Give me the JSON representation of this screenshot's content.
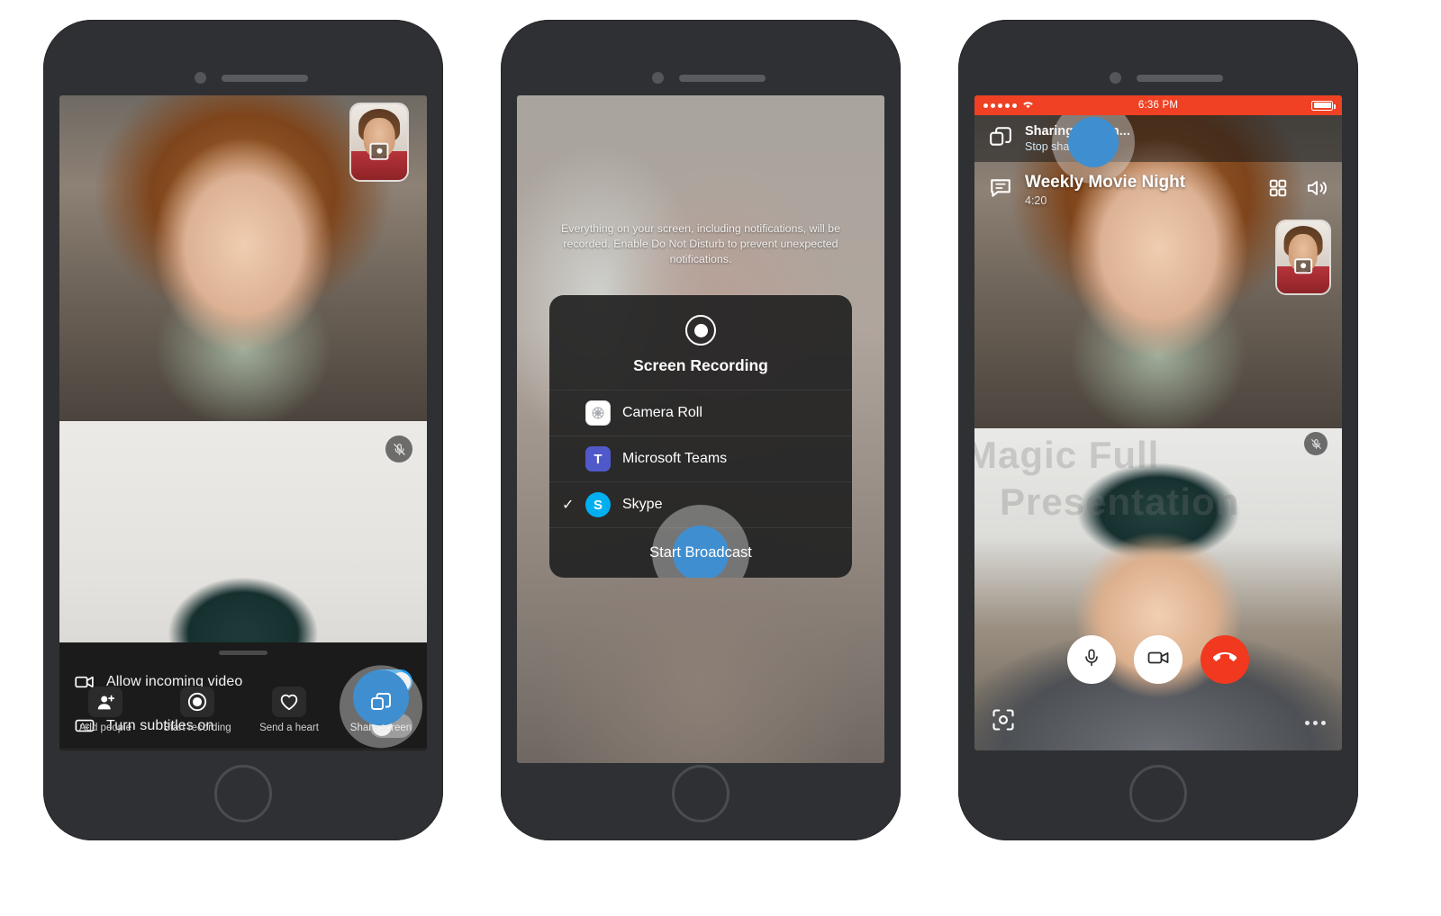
{
  "phone1": {
    "name": "skype-call-options-screen",
    "pip": {
      "icon": "camera-flip-icon"
    },
    "mute_badge": "mic-muted-icon",
    "options": [
      {
        "icon": "video-camera-icon",
        "label": "Allow incoming video",
        "toggle": "on"
      },
      {
        "icon": "closed-caption-icon",
        "label": "Turn subtitles on",
        "toggle": "off"
      }
    ],
    "actions": [
      {
        "icon": "add-person-icon",
        "label": "Add people"
      },
      {
        "icon": "record-circle-icon",
        "label": "Start recording"
      },
      {
        "icon": "heart-icon",
        "label": "Send a heart"
      },
      {
        "icon": "share-screen-icon",
        "label": "Share screen",
        "highlighted": true
      }
    ]
  },
  "phone2": {
    "name": "ios-screen-recording-broadcast-picker",
    "notice": "Everything on your screen, including notifications, will be recorded. Enable Do Not Disturb to prevent unexpected notifications.",
    "sheet_title": "Screen Recording",
    "sheet_icon": "record-circle-icon",
    "apps": [
      {
        "name": "Camera Roll",
        "icon": "camera-roll-icon",
        "selected": false,
        "color": "#ffffff",
        "glyph": ""
      },
      {
        "name": "Microsoft Teams",
        "icon": "microsoft-teams-icon",
        "selected": false,
        "color": "#5059C9",
        "glyph": "T"
      },
      {
        "name": "Skype",
        "icon": "skype-icon",
        "selected": true,
        "color": "#00AFF0",
        "glyph": "S"
      }
    ],
    "checkmark": "✓",
    "broadcast_button": "Start Broadcast"
  },
  "phone3": {
    "name": "skype-sharing-screen-call",
    "statusbar": {
      "signal": "signal-dots-icon",
      "wifi": "wifi-icon",
      "time": "6:36 PM",
      "battery": "battery-full-icon",
      "color": "#F04124"
    },
    "banner": {
      "icon": "share-screen-icon",
      "title": "Sharing screen...",
      "subtitle": "Stop sharing"
    },
    "header": {
      "icon": "chat-bubble-icon",
      "title": "Weekly Movie Night",
      "timer": "4:20",
      "right_icons": [
        "grid-view-icon",
        "speaker-icon"
      ]
    },
    "watermark_lines": [
      "Magic Full",
      "Presentation"
    ],
    "pip": {
      "icon": "camera-flip-icon"
    },
    "mute_badge": "mic-muted-icon",
    "call_buttons": [
      {
        "icon": "microphone-icon",
        "style": "white"
      },
      {
        "icon": "video-camera-icon",
        "style": "white"
      },
      {
        "icon": "end-call-icon",
        "style": "red"
      }
    ],
    "focus_icon": "camera-focus-icon",
    "more_icon": "more-options-icon"
  },
  "colors": {
    "accent": "#1a9cf0",
    "danger": "#F0391F",
    "status_red": "#F04124",
    "skype": "#00AFF0",
    "teams": "#5059C9"
  }
}
